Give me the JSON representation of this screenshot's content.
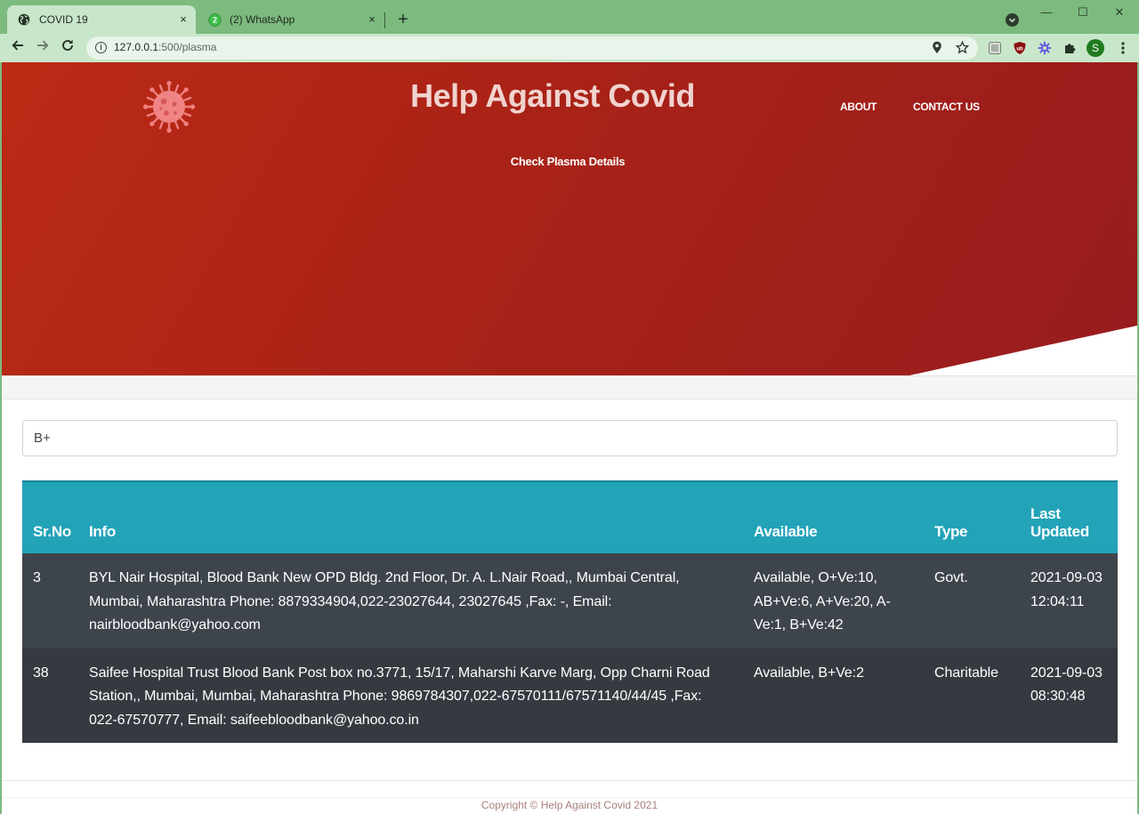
{
  "browser": {
    "tabs": [
      {
        "title": "COVID 19",
        "close": "×",
        "active": true,
        "icon": "globe-icon"
      },
      {
        "title": "(2) WhatsApp",
        "close": "×",
        "active": false,
        "icon": "whatsapp-icon",
        "badge": "2"
      }
    ],
    "new_tab": "+",
    "window_controls": {
      "minimize": "—",
      "maximize": "☐",
      "close": "✕"
    },
    "url_host": "127.0.0.1",
    "url_rest": ":500/plasma",
    "profile_initial": "S",
    "colors": {
      "frame": "#7cba7e",
      "toolbar": "#c8e6c9"
    }
  },
  "site": {
    "title": "Help Against Covid",
    "nav": {
      "about": "ABOUT",
      "contact": "CONTACT US"
    },
    "plasma_link": "Check Plasma Details",
    "colors": {
      "hero_start": "#bb2a15",
      "hero_end": "#981c1e",
      "table_header": "#22a3b8",
      "row_dark": "#3e444b"
    }
  },
  "search": {
    "value": "B+"
  },
  "table": {
    "headers": {
      "srno": "Sr.No",
      "info": "Info",
      "available": "Available",
      "type": "Type",
      "updated": "Last Updated"
    },
    "rows": [
      {
        "srno": "3",
        "info": "BYL Nair Hospital, Blood Bank New OPD Bldg. 2nd Floor, Dr. A. L.Nair Road,, Mumbai Central, Mumbai, Maharashtra Phone: 8879334904,022-23027644, 23027645 ,Fax: -, Email: nairbloodbank@yahoo.com",
        "available": "Available, O+Ve:10, AB+Ve:6, A+Ve:20, A-Ve:1, B+Ve:42",
        "type": "Govt.",
        "updated": "2021-09-03 12:04:11"
      },
      {
        "srno": "38",
        "info": "Saifee Hospital Trust Blood Bank Post box no.3771, 15/17, Maharshi Karve Marg, Opp Charni Road Station,, Mumbai, Mumbai, Maharashtra Phone: 9869784307,022-67570111/67571140/44/45 ,Fax: 022-67570777, Email: saifeebloodbank@yahoo.co.in",
        "available": "Available, B+Ve:2",
        "type": "Charitable",
        "updated": "2021-09-03 08:30:48"
      }
    ]
  },
  "footer": {
    "copyright": "Copyright © Help Against Covid 2021"
  }
}
